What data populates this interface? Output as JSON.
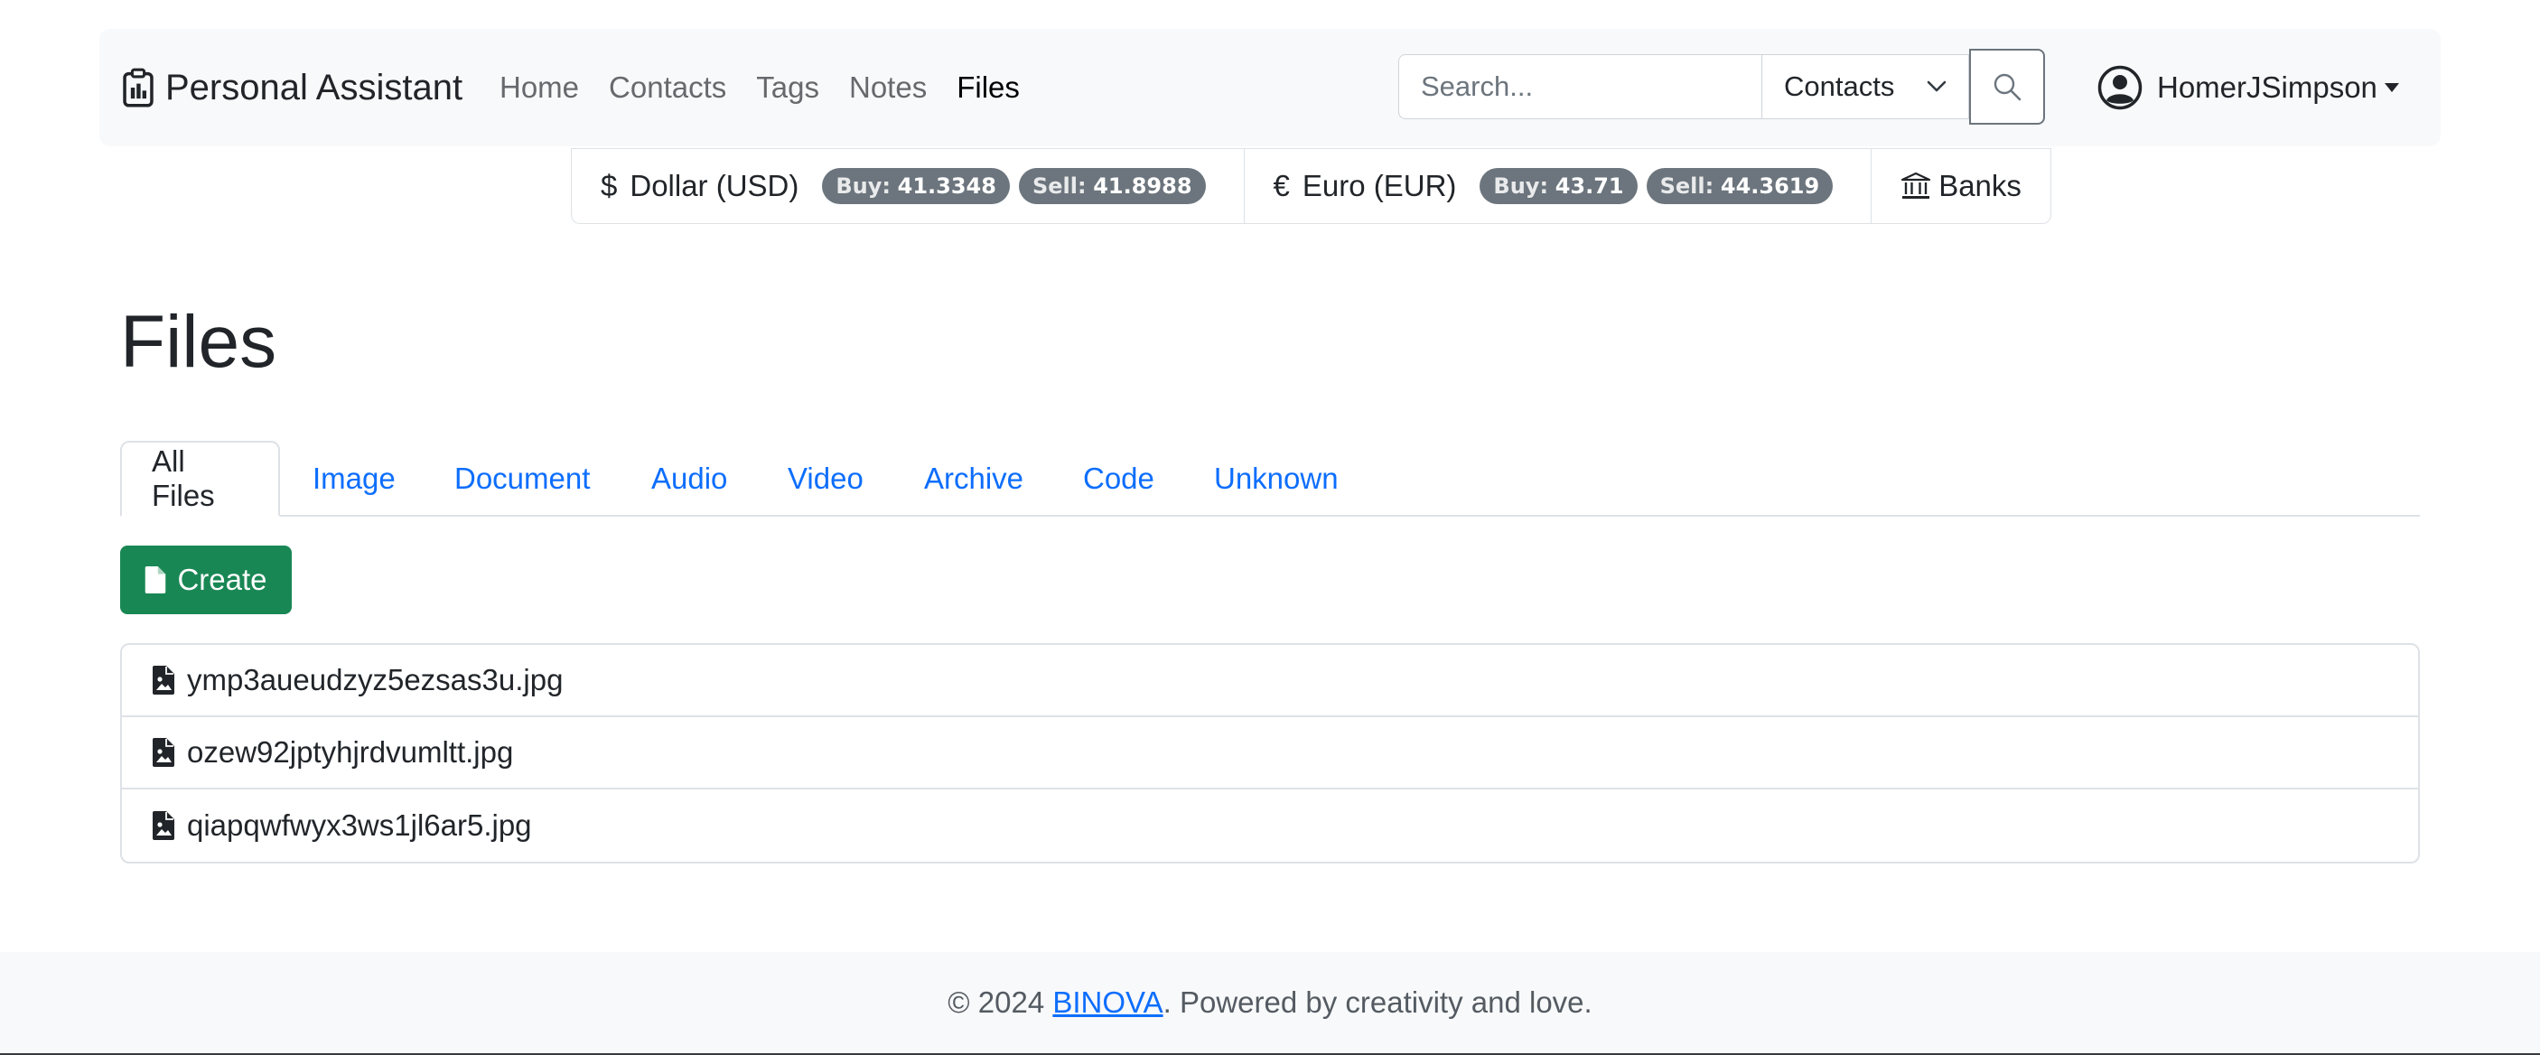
{
  "navbar": {
    "brand": "Personal Assistant",
    "links": [
      "Home",
      "Contacts",
      "Tags",
      "Notes",
      "Files"
    ],
    "active_link": "Files",
    "search": {
      "placeholder": "Search...",
      "scope": "Contacts"
    },
    "user": "HomerJSimpson"
  },
  "currency": {
    "usd": {
      "symbol": "$",
      "name": "Dollar (USD)",
      "buy_label": "Buy:",
      "buy": "41.3348",
      "sell_label": "Sell:",
      "sell": "41.8988"
    },
    "eur": {
      "symbol": "€",
      "name": "Euro (EUR)",
      "buy_label": "Buy:",
      "buy": "43.71",
      "sell_label": "Sell:",
      "sell": "44.3619"
    },
    "banks": "Banks"
  },
  "page": {
    "title": "Files",
    "tabs": [
      "All Files",
      "Image",
      "Document",
      "Audio",
      "Video",
      "Archive",
      "Code",
      "Unknown"
    ],
    "active_tab": "All Files",
    "create_label": "Create"
  },
  "files": [
    {
      "name": "ymp3aueudzyz5ezsas3u.jpg",
      "icon": "image-file-icon"
    },
    {
      "name": "ozew92jptyhjrdvumltt.jpg",
      "icon": "image-file-icon"
    },
    {
      "name": "qiapqwfwyx3ws1jl6ar5.jpg",
      "icon": "image-file-icon"
    }
  ],
  "footer": {
    "prefix": "© 2024 ",
    "link": "BINOVA",
    "suffix": ". Powered by creativity and love."
  },
  "colors": {
    "primary": "#0d6efd",
    "success": "#198754",
    "badge": "#6c757d",
    "navbar_bg": "#f8f9fa"
  }
}
